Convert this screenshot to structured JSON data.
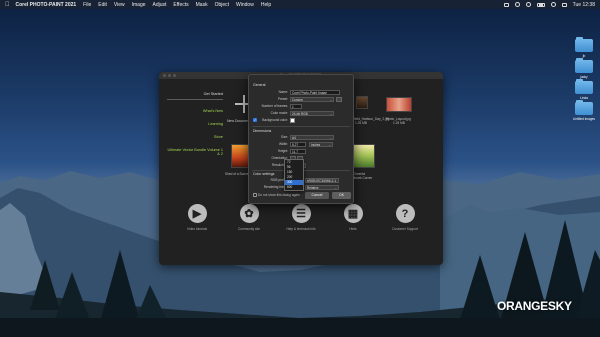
{
  "menubar": {
    "app_name": "Corel PHOTO-PAINT 2021",
    "menus": [
      "File",
      "Edit",
      "View",
      "Image",
      "Adjust",
      "Effects",
      "Mask",
      "Object",
      "Window",
      "Help"
    ],
    "clock": "Tue 12:38"
  },
  "desktop": {
    "icons": [
      "jb",
      "jacky",
      "Linda",
      "Untitled images"
    ]
  },
  "watermark": {
    "text": "ORANGESKY"
  },
  "welcome": {
    "title": "Corel PHOTO-PAINT 2021",
    "nav": [
      "Get Started",
      "What's New",
      "Learning",
      "Store",
      "Ultimate Vector Bundle Volume 1 & 2"
    ],
    "new_doc_label": "New Document",
    "recent_thumbs": [
      {
        "caption": "Wakefield_Harbour_Day_2.jpg",
        "sub": "1.25 MB"
      },
      {
        "caption": "Photo_Layout.jpg",
        "sub": "1.25 MB"
      },
      {
        "caption": "Shed of a Sunset_Ocean.jpg",
        "sub": ""
      },
      {
        "caption": "Cheerful",
        "sub": "Hallmark Corner"
      }
    ],
    "bottom_items": [
      {
        "label": "Video tutorials",
        "icon": "video-icon"
      },
      {
        "label": "Community site",
        "icon": "community-icon"
      },
      {
        "label": "Help & technical info",
        "icon": "help-book-icon"
      },
      {
        "label": "Hints",
        "icon": "book-icon"
      },
      {
        "label": "Customer Support",
        "icon": "question-icon"
      }
    ]
  },
  "dialog": {
    "general_label": "General",
    "name_label": "Name:",
    "name_value": "Corel Photo-Paint Image",
    "preset_label": "Preset:",
    "preset_value": "Custom",
    "frames_label": "Number of frames:",
    "frames_value": "1",
    "color_mode_label": "Color mode:",
    "color_mode_value": "24-bit RGB",
    "background_label": "Background color:",
    "dimensions_label": "Dimensions",
    "size_label": "Size:",
    "size_value": "A4",
    "width_label": "Width:",
    "width_value": "8.27",
    "width_unit": "inches",
    "height_label": "Height:",
    "height_value": "11.7",
    "orientation_label": "Orientation:",
    "resolution_label": "Resolution:",
    "resolution_value": "300",
    "color_settings_label": "Color settings",
    "rgb_profile_label": "RGB profile:",
    "rgb_profile_value": "sRGB IEC61966-2.1",
    "rendering_label": "Rendering intent:",
    "rendering_value": "Relative",
    "dont_show": "Do not show this dialog again",
    "ok_label": "OK",
    "cancel_label": "Cancel",
    "resolution_options": [
      "72",
      "96",
      "150",
      "200",
      "300",
      "600"
    ]
  }
}
